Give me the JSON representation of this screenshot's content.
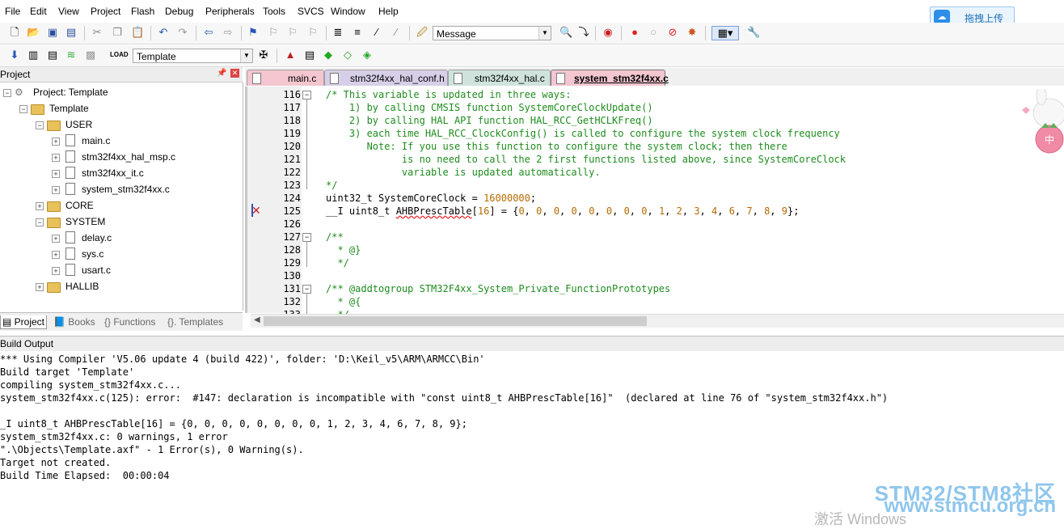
{
  "menu": [
    "File",
    "Edit",
    "View",
    "Project",
    "Flash",
    "Debug",
    "Peripherals",
    "Tools",
    "SVCS",
    "Window",
    "Help"
  ],
  "cloud_button": "拖拽上传",
  "toolbar1": {
    "message_combo": "Message"
  },
  "toolbar2": {
    "target_combo": "Template"
  },
  "project_panel": {
    "title": "Project",
    "root": "Project: Template",
    "target": "Template",
    "groups": [
      {
        "name": "USER",
        "files": [
          "main.c",
          "stm32f4xx_hal_msp.c",
          "stm32f4xx_it.c",
          "system_stm32f4xx.c"
        ]
      },
      {
        "name": "CORE",
        "files": []
      },
      {
        "name": "SYSTEM",
        "files": [
          "delay.c",
          "sys.c",
          "usart.c"
        ]
      },
      {
        "name": "HALLIB",
        "files": []
      }
    ],
    "tabs": [
      "Project",
      "Books",
      "{} Functions",
      "{}. Templates"
    ]
  },
  "editor_tabs": [
    "main.c",
    "stm32f4xx_hal_conf.h",
    "stm32f4xx_hal.c",
    "system_stm32f4xx.c"
  ],
  "code_lines": [
    {
      "n": "116",
      "t": "/* This variable is updated in three ways:"
    },
    {
      "n": "117",
      "t": "    1) by calling CMSIS function SystemCoreClockUpdate()"
    },
    {
      "n": "118",
      "t": "    2) by calling HAL API function HAL_RCC_GetHCLKFreq()"
    },
    {
      "n": "119",
      "t": "    3) each time HAL_RCC_ClockConfig() is called to configure the system clock frequency"
    },
    {
      "n": "120",
      "t": "       Note: If you use this function to configure the system clock; then there"
    },
    {
      "n": "121",
      "t": "             is no need to call the 2 first functions listed above, since SystemCoreClock"
    },
    {
      "n": "122",
      "t": "             variable is updated automatically."
    },
    {
      "n": "123",
      "t": "*/"
    },
    {
      "n": "124",
      "t": "uint32_t SystemCoreClock = 16000000;"
    },
    {
      "n": "125",
      "t": "__I uint8_t AHBPrescTable[16] = {0, 0, 0, 0, 0, 0, 0, 0, 1, 2, 3, 4, 6, 7, 8, 9};"
    },
    {
      "n": "126",
      "t": ""
    },
    {
      "n": "127",
      "t": "/**"
    },
    {
      "n": "128",
      "t": "  * @}"
    },
    {
      "n": "129",
      "t": "  */"
    },
    {
      "n": "130",
      "t": ""
    },
    {
      "n": "131",
      "t": "/** @addtogroup STM32F4xx_System_Private_FunctionPrototypes"
    },
    {
      "n": "132",
      "t": "  * @{"
    },
    {
      "n": "133",
      "t": "  */"
    }
  ],
  "build_output": {
    "title": "Build Output",
    "lines": [
      "*** Using Compiler 'V5.06 update 4 (build 422)', folder: 'D:\\Keil_v5\\ARM\\ARMCC\\Bin'",
      "Build target 'Template'",
      "compiling system_stm32f4xx.c...",
      "system_stm32f4xx.c(125): error:  #147: declaration is incompatible with \"const uint8_t AHBPrescTable[16]\"  (declared at line 76 of \"system_stm32f4xx.h\")",
      "",
      "_I uint8_t AHBPrescTable[16] = {0, 0, 0, 0, 0, 0, 0, 0, 1, 2, 3, 4, 6, 7, 8, 9};",
      "system_stm32f4xx.c: 0 warnings, 1 error",
      "\".\\Objects\\Template.axf\" - 1 Error(s), 0 Warning(s).",
      "Target not created.",
      "Build Time Elapsed:  00:00:04"
    ]
  },
  "watermark": {
    "line1": "STM32/STM8社区",
    "line2": "www.stmcu.org.cn",
    "activate": "激活 Windows"
  },
  "bunny_badge": "中",
  "colors": {
    "comment": "#1e8c1e",
    "number": "#b56a00",
    "accent_tab": "#f3c6d0",
    "folder": "#e8c15a"
  }
}
